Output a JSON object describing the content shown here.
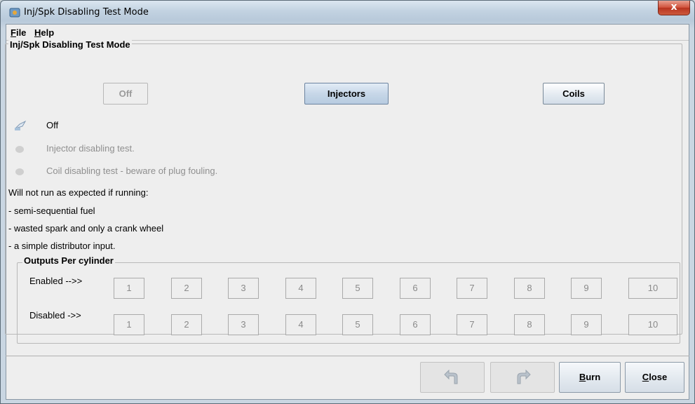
{
  "window": {
    "title": "Inj/Spk Disabling Test Mode",
    "close_glyph": "x"
  },
  "menu": {
    "file": "File",
    "file_mnemonic": "F",
    "file_rest": "ile",
    "help_mnemonic": "H",
    "help_rest": "elp"
  },
  "panel": {
    "title": "Inj/Spk Disabling Test Mode",
    "mode_buttons": {
      "off": "Off",
      "injectors": "Injectors",
      "coils": "Coils"
    },
    "radios": [
      {
        "label": "Off",
        "selected": true,
        "enabled": true
      },
      {
        "label": "Injector disabling test.",
        "selected": false,
        "enabled": false
      },
      {
        "label": "Coil disabling test - beware of plug fouling.",
        "selected": false,
        "enabled": false
      }
    ],
    "notes": [
      "Will not run as expected if running:",
      "- semi-sequential fuel",
      "- wasted spark and only a crank wheel",
      "- a simple distributor input."
    ]
  },
  "outputs": {
    "title": "Outputs Per cylinder",
    "enabled_label": "Enabled -->>",
    "disabled_label": "Disabled ->>",
    "cylinders": [
      "1",
      "2",
      "3",
      "4",
      "5",
      "6",
      "7",
      "8",
      "9",
      "10"
    ]
  },
  "footer": {
    "undo_icon": "undo-icon",
    "redo_icon": "redo-icon",
    "burn_mnemonic": "B",
    "burn_rest": "urn",
    "close_mnemonic": "C",
    "close_rest": "lose"
  }
}
